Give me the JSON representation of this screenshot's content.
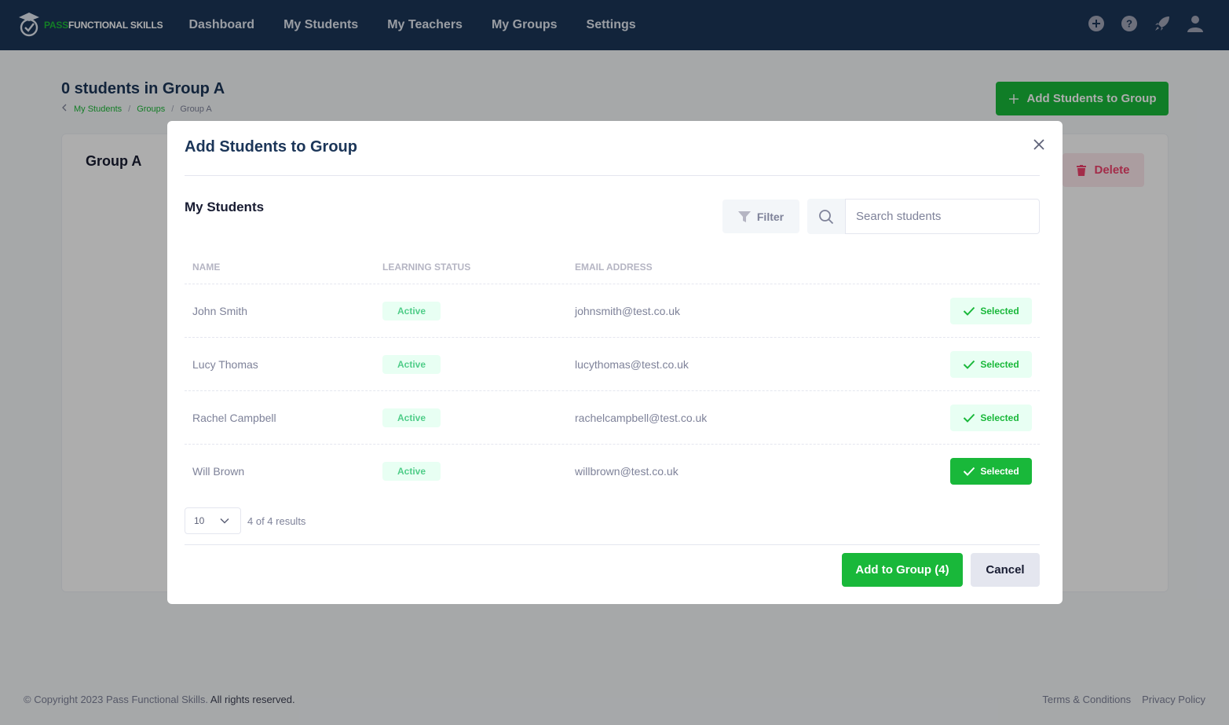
{
  "brand": {
    "pass": "PASS",
    "rest": "FUNCTIONAL SKILLS"
  },
  "nav": {
    "links": [
      "Dashboard",
      "My Students",
      "My Teachers",
      "My Groups",
      "Settings"
    ],
    "icons": [
      "plus-circle-icon",
      "help-icon",
      "rocket-icon",
      "user-icon"
    ]
  },
  "page": {
    "title": "0 students in Group A",
    "breadcrumb": [
      "My Students",
      "Groups",
      "Group A"
    ],
    "add_button": "Add Students to Group"
  },
  "group_card": {
    "title": "Group A",
    "delete_button": "Delete"
  },
  "modal": {
    "title": "Add Students to Group",
    "section_title": "My Students",
    "filter_label": "Filter",
    "search_placeholder": "Search students",
    "columns": [
      "NAME",
      "LEARNING STATUS",
      "EMAIL ADDRESS"
    ],
    "rows": [
      {
        "name": "John Smith",
        "status": "Active",
        "email": "johnsmith@test.co.uk",
        "action": "Selected",
        "highlighted": false
      },
      {
        "name": "Lucy Thomas",
        "status": "Active",
        "email": "lucythomas@test.co.uk",
        "action": "Selected",
        "highlighted": false
      },
      {
        "name": "Rachel Campbell",
        "status": "Active",
        "email": "rachelcampbell@test.co.uk",
        "action": "Selected",
        "highlighted": false
      },
      {
        "name": "Will Brown",
        "status": "Active",
        "email": "willbrown@test.co.uk",
        "action": "Selected",
        "highlighted": true
      }
    ],
    "page_size": "10",
    "results_text": "4 of 4 results",
    "add_button": "Add to Group (4)",
    "cancel_button": "Cancel"
  },
  "footer": {
    "copyright_prefix": "© Copyright 2023 Pass Functional Skills.",
    "copyright_suffix": " All rights reserved.",
    "links": [
      "Terms & Conditions",
      "Privacy Policy"
    ]
  },
  "colors": {
    "navbar": "#1b3558",
    "brand_green": "#19b83a",
    "danger": "#f1416c"
  }
}
